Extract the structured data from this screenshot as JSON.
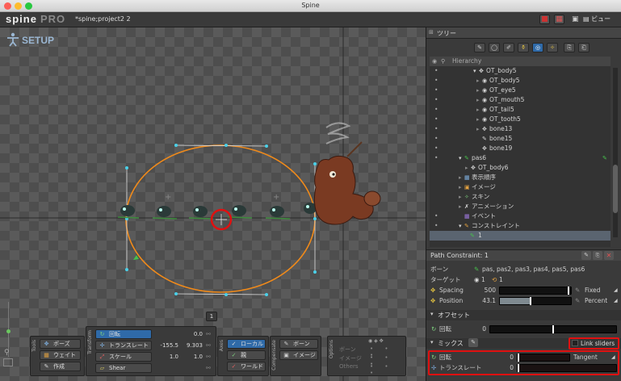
{
  "window": {
    "title": "Spine",
    "project": "*spine;project2 2"
  },
  "logo": {
    "name": "spine",
    "edition": "PRO"
  },
  "topbar": {
    "view_label": "ビュー"
  },
  "viewer": {
    "mode_label": "SETUP",
    "page_indicator": "1"
  },
  "tools_panel": {
    "label": "Tools",
    "buttons": [
      {
        "label": "ポーズ",
        "icon": "pose-icon"
      },
      {
        "label": "ウェイト",
        "icon": "weight-icon"
      },
      {
        "label": "作成",
        "icon": "create-icon"
      }
    ]
  },
  "transform_panel": {
    "label": "Transform",
    "rows": [
      {
        "label": "回転",
        "values": [
          "0.0"
        ],
        "icon": "rotate-icon"
      },
      {
        "label": "トランスレート",
        "values": [
          "-155.5",
          "9.303"
        ],
        "icon": "translate-icon"
      },
      {
        "label": "スケール",
        "values": [
          "1.0",
          "1.0"
        ],
        "icon": "scale-icon"
      },
      {
        "label": "Shear",
        "values": [],
        "icon": "shear-icon"
      }
    ]
  },
  "axes_panel": {
    "label": "Axes",
    "buttons": [
      {
        "label": "ローカル"
      },
      {
        "label": "親"
      },
      {
        "label": "ワールド"
      }
    ]
  },
  "compensate_panel": {
    "label": "Compensate",
    "buttons": [
      {
        "label": "ボーン"
      },
      {
        "label": "イメージ"
      }
    ]
  },
  "options_panel": {
    "label": "Options",
    "rows": [
      "ボーン",
      "イメージ",
      "Others"
    ]
  },
  "tree": {
    "tab_label": "ツリー",
    "header_label": "Hierarchy",
    "items": [
      {
        "label": "OT_body5"
      },
      {
        "label": "OT_body5"
      },
      {
        "label": "OT_eye5"
      },
      {
        "label": "OT_mouth5"
      },
      {
        "label": "OT_tail5"
      },
      {
        "label": "OT_tooth5"
      },
      {
        "label": "bone13"
      },
      {
        "label": "bone15"
      },
      {
        "label": "bone19"
      },
      {
        "label": "pas6"
      },
      {
        "label": "OT_body6"
      },
      {
        "label": "表示順序"
      },
      {
        "label": "イメージ"
      },
      {
        "label": "スキン"
      },
      {
        "label": "アニメーション"
      },
      {
        "label": "イベント"
      },
      {
        "label": "コンストレイント"
      },
      {
        "label": "1"
      }
    ]
  },
  "properties": {
    "title": "Path Constraint: 1",
    "bones_label": "ボーン",
    "bones_value": "pas, pas2, pas3, pas4, pas5, pas6",
    "target_label": "ターゲット",
    "target_options": [
      "1",
      "1"
    ],
    "spacing_label": "Spacing",
    "spacing_value": "500",
    "spacing_mode": "Fixed",
    "spacing_fill": 0.97,
    "position_label": "Position",
    "position_value": "43.1",
    "position_mode": "Percent",
    "position_fill": 0.43,
    "offset_section": "オフセット",
    "offset_rotate_label": "回転",
    "offset_rotate_value": "0",
    "offset_rotate_fill": 0.5,
    "mix_section": "ミックス",
    "link_sliders_label": "Link sliders",
    "mix_rotate_label": "回転",
    "mix_rotate_value": "0",
    "mix_rotate_mode": "Tangent",
    "mix_rotate_fill": 0.0,
    "mix_translate_label": "トランスレート",
    "mix_translate_value": "0",
    "mix_translate_fill": 0.0
  },
  "colors": {
    "accent": "#2f6aa8",
    "path": "#f08a1a",
    "highlight": "#e01010",
    "bone": "#4ad0e8"
  }
}
